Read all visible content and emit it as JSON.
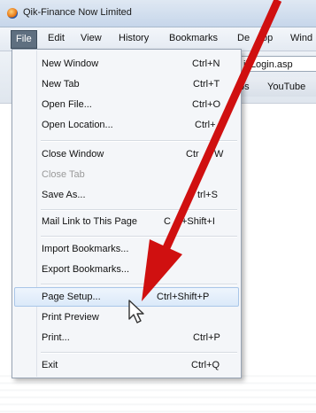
{
  "window": {
    "title": "Qik-Finance Now Limited"
  },
  "menubar": {
    "items": [
      {
        "label": "File"
      },
      {
        "label": "Edit"
      },
      {
        "label": "View"
      },
      {
        "label": "History"
      },
      {
        "label": "Bookmarks"
      },
      {
        "label": "De"
      },
      {
        "label": "op"
      },
      {
        "label": "Wind"
      }
    ]
  },
  "address": {
    "value": "ikLogin.asp"
  },
  "bookmarks_bar": {
    "items": [
      {
        "label": "ps"
      },
      {
        "label": "YouTube"
      }
    ]
  },
  "file_menu": {
    "items": [
      {
        "label": "New Window",
        "shortcut": "Ctrl+N"
      },
      {
        "label": "New Tab",
        "shortcut": "Ctrl+T"
      },
      {
        "label": "Open File...",
        "shortcut": "Ctrl+O"
      },
      {
        "label": "Open Location...",
        "shortcut": "Ctrl+"
      },
      {
        "label": "Close Window",
        "shortcut": "Ctr"
      },
      {
        "label": "W",
        "shortcut": ""
      },
      {
        "label": "Close Tab",
        "shortcut": ""
      },
      {
        "label": "Save As...",
        "shortcut": "trl+S"
      },
      {
        "label": "Mail Link to This Page",
        "shortcut": "C"
      },
      {
        "label": "+Shift+I",
        "shortcut": ""
      },
      {
        "label": "Import Bookmarks...",
        "shortcut": ""
      },
      {
        "label": "Export Bookmarks...",
        "shortcut": ""
      },
      {
        "label": "Page Setup...",
        "shortcut": "Ctrl+Shift+P"
      },
      {
        "label": "Print Preview",
        "shortcut": ""
      },
      {
        "label": "Print...",
        "shortcut": "Ctrl+P"
      },
      {
        "label": "Exit",
        "shortcut": "Ctrl+Q"
      }
    ]
  },
  "colors": {
    "arrow": "#d01010",
    "highlight": "#dbe9f9",
    "active_menu": "#5f6f80"
  }
}
